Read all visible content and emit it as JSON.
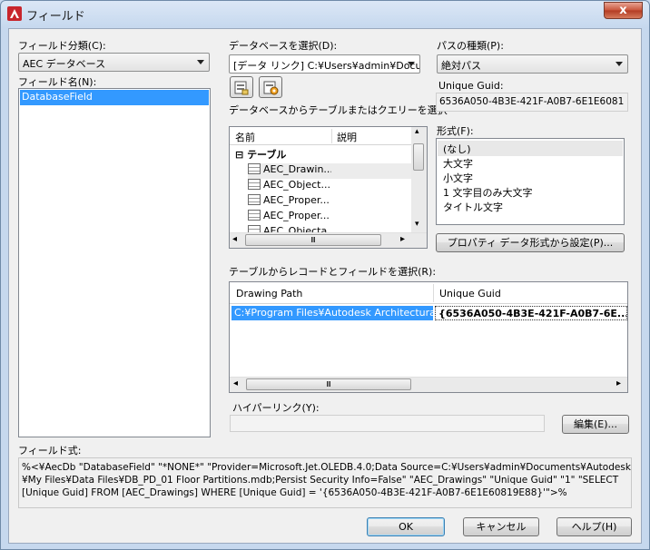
{
  "window": {
    "title": "フィールド",
    "close_label": "x"
  },
  "field_category": {
    "label": "フィールド分類(C):",
    "value": "AEC データベース"
  },
  "field_names": {
    "label": "フィールド名(N):",
    "items": [
      "DatabaseField"
    ]
  },
  "database": {
    "label": "データベースを選択(D):",
    "value": "[データ リンク] C:¥Users¥admin¥Docur"
  },
  "table_select": {
    "label": "データベースからテーブルまたはクエリーを選択",
    "columns": [
      "名前",
      "説明"
    ],
    "group": "テーブル",
    "group_toggle": "⊟",
    "items": [
      "AEC_Drawin...",
      "AEC_Object...",
      "AEC_Proper...",
      "AEC_Proper...",
      "AEC_Objecta"
    ]
  },
  "path_type": {
    "label": "パスの種類(P):",
    "value": "絶対パス"
  },
  "unique_guid": {
    "label": "Unique Guid:",
    "value": "6536A050-4B3E-421F-A0B7-6E1E6081"
  },
  "format": {
    "label": "形式(F):",
    "items": [
      "(なし)",
      "大文字",
      "小文字",
      "1 文字目のみ大文字",
      "タイトル文字"
    ],
    "selected_index": 0
  },
  "property_format_button": "プロパティ データ形式から設定(P)...",
  "records": {
    "label": "テーブルからレコードとフィールドを選択(R):",
    "columns": [
      "Drawing Path",
      "Unique Guid"
    ],
    "rows": [
      [
        "C:¥Program Files¥Autodesk Architectural...",
        "{6536A050-4B3E-421F-A0B7-6E..."
      ]
    ]
  },
  "hyperlink": {
    "label": "ハイパーリンク(Y):",
    "value": "",
    "edit_button": "編集(E)..."
  },
  "field_expression": {
    "label": "フィールド式:",
    "lines": [
      "%<¥AecDb \"DatabaseField\" \"*NONE*\" \"Provider=Microsoft.Jet.OLEDB.4.0;Data Source=C:¥Users¥admin¥Documents¥Autodesk",
      "¥My Files¥Data Files¥DB_PD_01 Floor Partitions.mdb;Persist Security Info=False\" \"AEC_Drawings\" \"Unique Guid\" \"1\" \"SELECT",
      "[Unique Guid] FROM [AEC_Drawings] WHERE [Unique Guid] = '{6536A050-4B3E-421F-A0B7-6E1E60819E88}'\">%"
    ]
  },
  "buttons": {
    "ok": "OK",
    "cancel": "キャンセル",
    "help": "ヘルプ(H)"
  },
  "scroll": {
    "left": "◂",
    "right": "▸",
    "up": "▴",
    "down": "▾",
    "grip": "Ⅲ"
  },
  "colors": {
    "selection": "#3399ff",
    "app_icon": "#c8252c"
  }
}
